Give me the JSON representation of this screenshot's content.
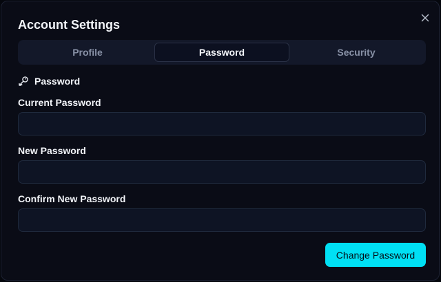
{
  "dialog": {
    "title": "Account Settings"
  },
  "tabs": [
    {
      "label": "Profile",
      "active": false
    },
    {
      "label": "Password",
      "active": true
    },
    {
      "label": "Security",
      "active": false
    }
  ],
  "section": {
    "icon": "key-icon",
    "title": "Password"
  },
  "fields": {
    "current": {
      "label": "Current Password",
      "value": "",
      "placeholder": ""
    },
    "new": {
      "label": "New Password",
      "value": "",
      "placeholder": ""
    },
    "confirm": {
      "label": "Confirm New Password",
      "value": "",
      "placeholder": ""
    }
  },
  "actions": {
    "submit_label": "Change Password"
  },
  "colors": {
    "accent": "#00e0f4",
    "background": "#0a0c16",
    "input_bg": "#0e1424",
    "tab_bar_bg": "#131829",
    "text": "#f2f4f8",
    "muted_text": "#8891a6"
  }
}
